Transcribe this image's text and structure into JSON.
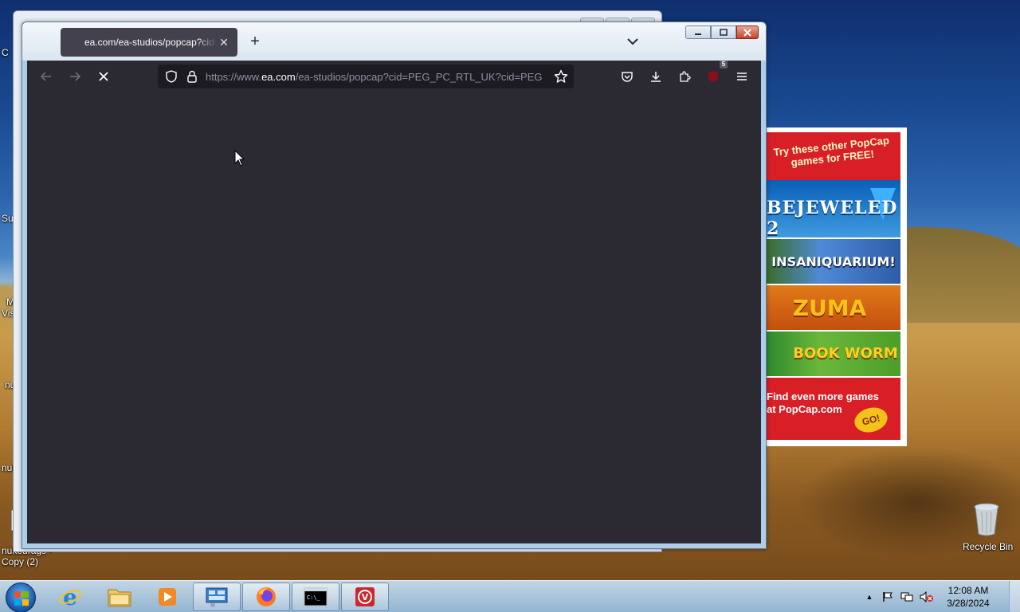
{
  "desktop": {
    "icons": [
      {
        "label": "nukeurags - Copy (2)"
      },
      {
        "label": "Recycle Bin"
      }
    ],
    "partial_labels": [
      "C",
      "Su",
      "M",
      "Vis",
      "nu",
      "nuke",
      "C"
    ]
  },
  "ad_panel": {
    "promo": "Try these other PopCap games for FREE!",
    "games": [
      {
        "title": "BEJEWELED 2"
      },
      {
        "title": "INSANIQUARIUM!"
      },
      {
        "title": "ZUMA"
      },
      {
        "title": "BOOK WORM"
      }
    ],
    "footer_line1": "Find even more games",
    "footer_line2": "at PopCap.com",
    "go_label": "GO!"
  },
  "browser": {
    "tab": {
      "title": "ea.com/ea-studios/popcap?cid=PEG_PC_RTL_UK?cid=PEG"
    },
    "url": {
      "prefix": "https://www.",
      "host": "ea.com",
      "path": "/ea-studios/popcap?cid=PEG_PC_RTL_UK?cid=PEG"
    },
    "extension_badge": "5",
    "colors": {
      "toolbar": "#2b2a33",
      "urlbar": "#1c1b22",
      "tab": "#42414d"
    }
  },
  "taskbar": {
    "clock_time": "12:08 AM",
    "clock_date": "3/28/2024",
    "items": [
      "internet-explorer",
      "file-explorer",
      "media-player",
      "control-panel",
      "firefox",
      "command-prompt",
      "app"
    ]
  }
}
